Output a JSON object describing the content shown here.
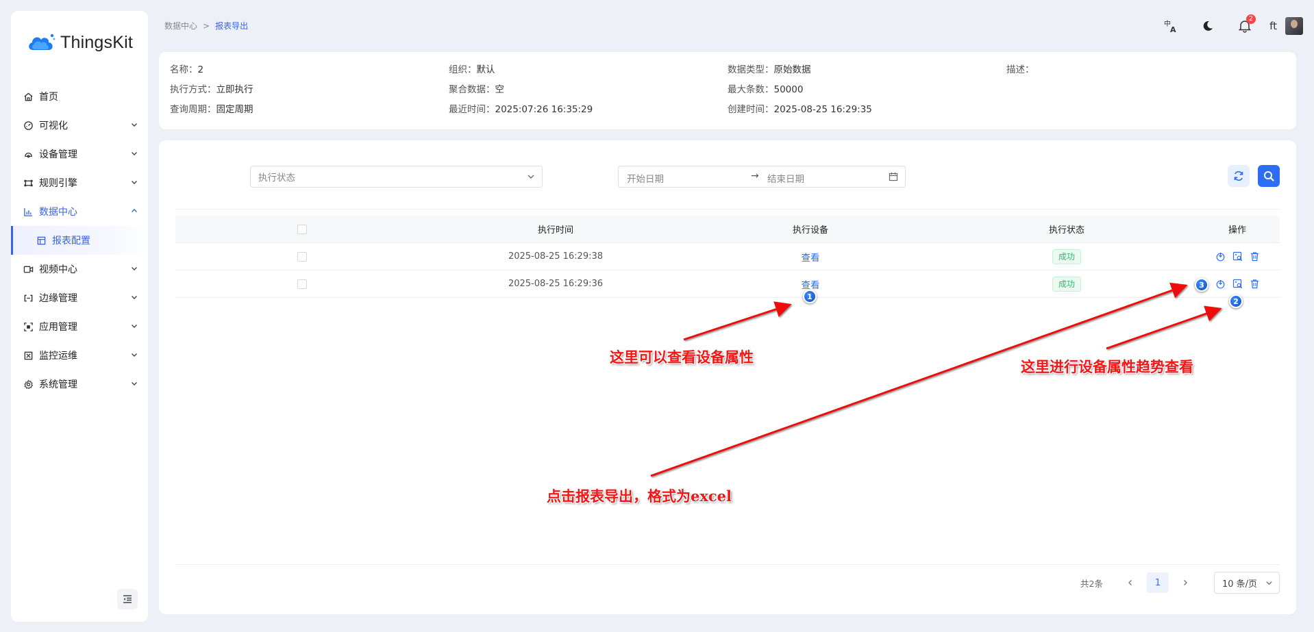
{
  "app": {
    "logo_text": "ThingsKit"
  },
  "sidebar": {
    "items": [
      {
        "label": "首页"
      },
      {
        "label": "可视化"
      },
      {
        "label": "设备管理"
      },
      {
        "label": "规则引擎"
      },
      {
        "label": "数据中心"
      },
      {
        "label": "报表配置"
      },
      {
        "label": "视频中心"
      },
      {
        "label": "边缘管理"
      },
      {
        "label": "应用管理"
      },
      {
        "label": "监控运维"
      },
      {
        "label": "系统管理"
      }
    ]
  },
  "breadcrumb": {
    "parent": "数据中心",
    "separator": ">",
    "current": "报表导出"
  },
  "header": {
    "notification_count": "2",
    "user_name": "ft"
  },
  "info": {
    "name_key": "名称：",
    "name_val": "2",
    "org_key": "组织：",
    "org_val": "默认",
    "dtype_key": "数据类型：",
    "dtype_val": "原始数据",
    "desc_key": "描述：",
    "desc_val": "",
    "exec_key": "执行方式：",
    "exec_val": "立即执行",
    "agg_key": "聚合数据：",
    "agg_val": "空",
    "max_key": "最大条数：",
    "max_val": "50000",
    "period_key": "查询周期：",
    "period_val": "固定周期",
    "recent_key": "最近时间：",
    "recent_val": "2025:07:26 16:35:29",
    "created_key": "创建时间：",
    "created_val": "2025-08-25 16:29:35"
  },
  "filters": {
    "status_placeholder": "执行状态",
    "start_placeholder": "开始日期",
    "range_sep": "→",
    "end_placeholder": "结束日期"
  },
  "table": {
    "headers": {
      "time": "执行时间",
      "device": "执行设备",
      "status": "执行状态",
      "op": "操作"
    },
    "rows": [
      {
        "time": "2025-08-25 16:29:38",
        "device": "查看",
        "status": "成功"
      },
      {
        "time": "2025-08-25 16:29:36",
        "device": "查看",
        "status": "成功"
      }
    ]
  },
  "pagination": {
    "total": "共2条",
    "current": "1",
    "page_size": "10 条/页"
  },
  "annotations": {
    "a1": "这里可以查看设备属性",
    "a2": "这里进行设备属性趋势查看",
    "a3": "点击报表导出，格式为excel",
    "m1": "1",
    "m2": "2",
    "m3": "3"
  },
  "colors": {
    "accent": "#2d6df6",
    "success": "#36b573",
    "annotation": "#f31616"
  }
}
